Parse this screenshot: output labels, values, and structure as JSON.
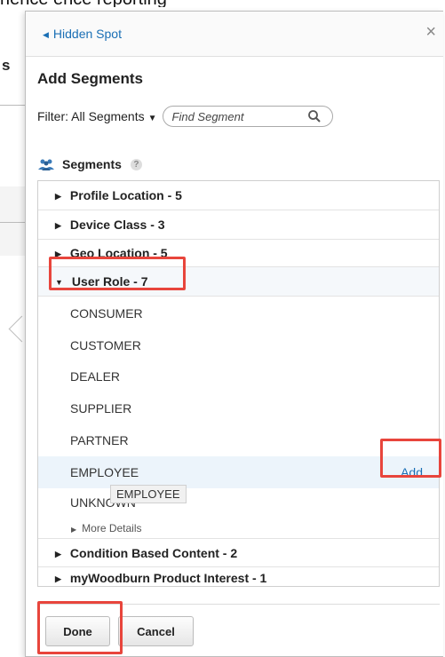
{
  "background": {
    "top_text": "rience   ence reporting",
    "side_letter": "s"
  },
  "dialog": {
    "back_link": "Hidden Spot",
    "close": "×",
    "title": "Add Segments",
    "filter_label": "Filter: All Segments",
    "search_placeholder": "Find Segment",
    "segments_header": "Segments",
    "help": "?",
    "groups": [
      {
        "label": "Profile Location - 5",
        "expanded": false
      },
      {
        "label": "Device Class - 3",
        "expanded": false
      },
      {
        "label": "Geo Location - 5",
        "expanded": false
      },
      {
        "label": "User Role - 7",
        "expanded": true
      },
      {
        "label": "Condition Based Content - 2",
        "expanded": false
      },
      {
        "label": "myWoodburn Product Interest - 1",
        "expanded": false
      }
    ],
    "user_role_items": [
      "CONSUMER",
      "CUSTOMER",
      "DEALER",
      "SUPPLIER",
      "PARTNER",
      "EMPLOYEE",
      "UNKNOWN"
    ],
    "add_label": "Add",
    "tooltip": "EMPLOYEE",
    "more_details": "More Details",
    "done_label": "Done",
    "cancel_label": "Cancel"
  },
  "colors": {
    "link": "#1a6fb5",
    "highlight_row": "#ecf4fb",
    "annotation_red": "#e8453c"
  }
}
